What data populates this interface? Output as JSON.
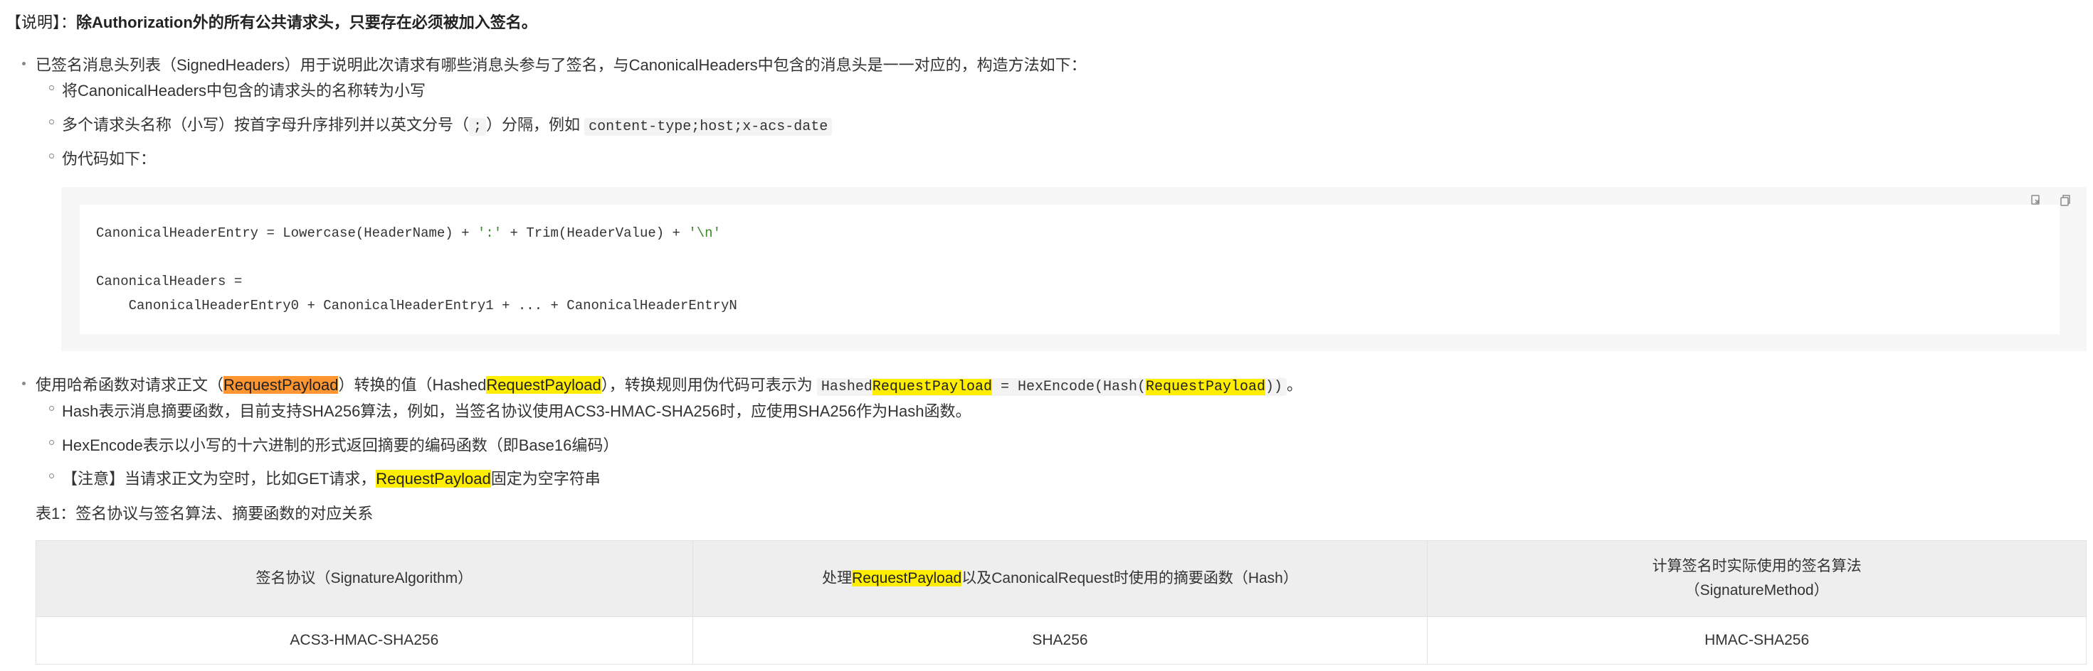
{
  "note": {
    "prefix": "【说明】：",
    "text": "除Authorization外的所有公共请求头，只要存在必须被加入签名。"
  },
  "signed_headers": {
    "intro": "已签名消息头列表（SignedHeaders）用于说明此次请求有哪些消息头参与了签名，与CanonicalHeaders中包含的消息头是一一对应的，构造方法如下：",
    "items": {
      "lowercase": "将CanonicalHeaders中包含的请求头的名称转为小写",
      "sort_prefix": "多个请求头名称（小写）按首字母升序排列并以英文分号（",
      "semicolon": ";",
      "sort_suffix": "）分隔，例如",
      "sort_example": "content-type;host;x-acs-date",
      "pseudo": "伪代码如下："
    }
  },
  "code_block": {
    "line1_a": "CanonicalHeaderEntry = Lowercase(HeaderName) + ",
    "line1_colon": "':'",
    "line1_b": " + Trim(HeaderValue) + ",
    "line1_newline": "'\\n'",
    "line2": "CanonicalHeaders =",
    "line3": "    CanonicalHeaderEntry0 + CanonicalHeaderEntry1 + ... + CanonicalHeaderEntryN",
    "copy_icon": "copy-icon",
    "clipboard_icon": "clipboard-icon"
  },
  "payload": {
    "intro_a": "使用哈希函数对请求正文（",
    "request_payload": "RequestPayload",
    "intro_b": "）转换的值（Hashed",
    "intro_c": "），转换规则用伪代码可表示为",
    "code_hashed": "Hashed",
    "code_eq": " = HexEncode(Hash(",
    "code_end": "))",
    "period": "。",
    "hash_desc": "Hash表示消息摘要函数，目前支持SHA256算法，例如，当签名协议使用ACS3-HMAC-SHA256时，应使用SHA256作为Hash函数。",
    "hexencode_desc": "HexEncode表示以小写的十六进制的形式返回摘要的编码函数（即Base16编码）",
    "empty_a": "【注意】当请求正文为空时，比如GET请求，",
    "empty_b": "固定为空字符串"
  },
  "table": {
    "caption": "表1：签名协议与签名算法、摘要函数的对应关系",
    "headers": {
      "col1": "签名协议（SignatureAlgorithm）",
      "col2_a": "处理",
      "col2_hl": "RequestPayload",
      "col2_b": "以及CanonicalRequest时使用的摘要函数（Hash）",
      "col3_line1": "计算签名时实际使用的签名算法",
      "col3_line2": "（SignatureMethod）"
    },
    "rows": [
      {
        "protocol": "ACS3-HMAC-SHA256",
        "hash": "SHA256",
        "method": "HMAC-SHA256"
      }
    ]
  }
}
